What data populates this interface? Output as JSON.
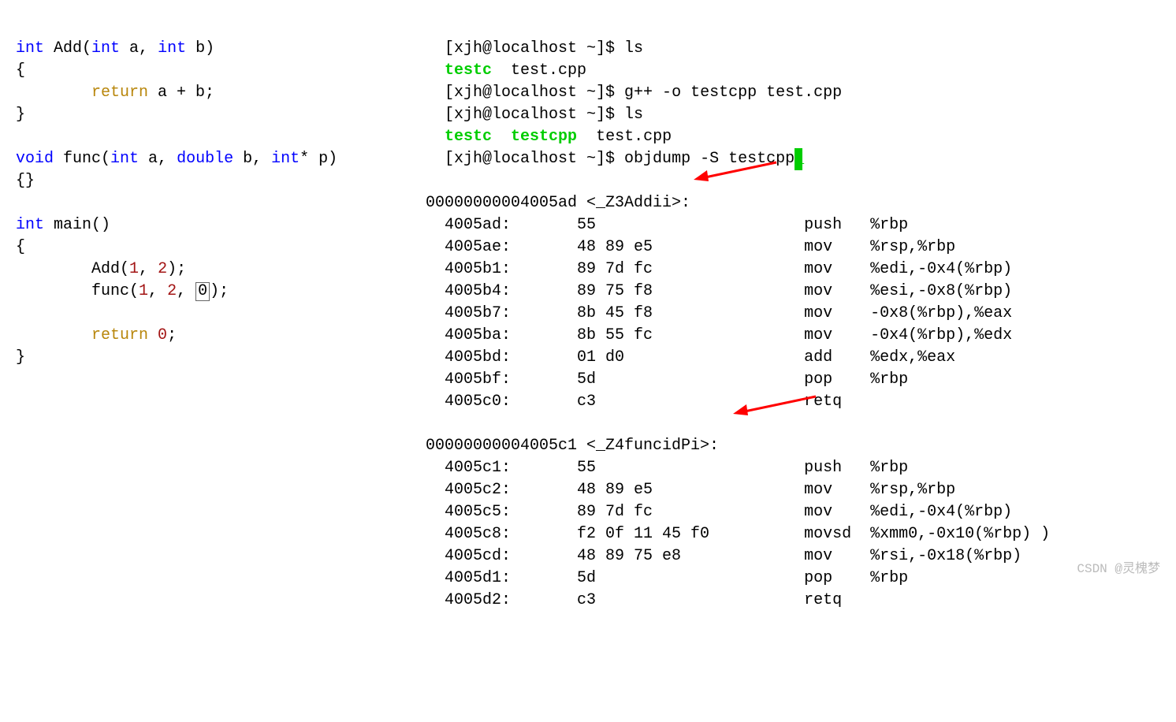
{
  "code": {
    "l1a": "int",
    "l1b": " Add(",
    "l1c": "int",
    "l1d": " a, ",
    "l1e": "int",
    "l1f": " b)",
    "l2": "{",
    "l3a": "        ",
    "l3b": "return",
    "l3c": " a + b;",
    "l4": "}",
    "l5": "",
    "l6a": "void",
    "l6b": " func(",
    "l6c": "int",
    "l6d": " a, ",
    "l6e": "double",
    "l6f": " b, ",
    "l6g": "int",
    "l6h": "* p)",
    "l7": "{}",
    "l8": "",
    "l9a": "int",
    "l9b": " main()",
    "l10": "{",
    "l11a": "        Add(",
    "l11b": "1",
    "l11c": ", ",
    "l11d": "2",
    "l11e": ");",
    "l12a": "        func(",
    "l12b": "1",
    "l12c": ", ",
    "l12d": "2",
    "l12e": ", ",
    "l12f": "0",
    "l12g": ");",
    "l13": "",
    "l14a": "        ",
    "l14b": "return",
    "l14c": " ",
    "l14d": "0",
    "l14e": ";",
    "l15": "}"
  },
  "term": {
    "t1": "[xjh@localhost ~]$ ls",
    "t2a": "testc",
    "t2b": "  test.cpp",
    "t3": "[xjh@localhost ~]$ g++ -o testcpp test.cpp",
    "t4": "[xjh@localhost ~]$ ls",
    "t5a": "testc",
    "t5b": "  ",
    "t5c": "testcpp",
    "t5d": "  test.cpp",
    "t6": "[xjh@localhost ~]$ objdump -S testcpp",
    "hdr1": "00000000004005ad <_Z3Addii>:",
    "a1": "  4005ad:       55                      push   %rbp",
    "a2": "  4005ae:       48 89 e5                mov    %rsp,%rbp",
    "a3": "  4005b1:       89 7d fc                mov    %edi,-0x4(%rbp)",
    "a4": "  4005b4:       89 75 f8                mov    %esi,-0x8(%rbp)",
    "a5": "  4005b7:       8b 45 f8                mov    -0x8(%rbp),%eax",
    "a6": "  4005ba:       8b 55 fc                mov    -0x4(%rbp),%edx",
    "a7": "  4005bd:       01 d0                   add    %edx,%eax",
    "a8": "  4005bf:       5d                      pop    %rbp",
    "a9": "  4005c0:       c3                      retq",
    "hdr2": "00000000004005c1 <_Z4funcidPi>:",
    "b1": "  4005c1:       55                      push   %rbp",
    "b2": "  4005c2:       48 89 e5                mov    %rsp,%rbp",
    "b3": "  4005c5:       89 7d fc                mov    %edi,-0x4(%rbp)",
    "b4": "  4005c8:       f2 0f 11 45 f0          movsd  %xmm0,-0x10(%rbp)",
    "b5": "  4005cd:       48 89 75 e8             mov    %rsi,-0x18(%rbp)",
    "b6": "  4005d1:       5d                      pop    %rbp",
    "b7": "  4005d2:       c3                      retq",
    "paren": ")"
  },
  "watermark": "CSDN @灵槐梦"
}
